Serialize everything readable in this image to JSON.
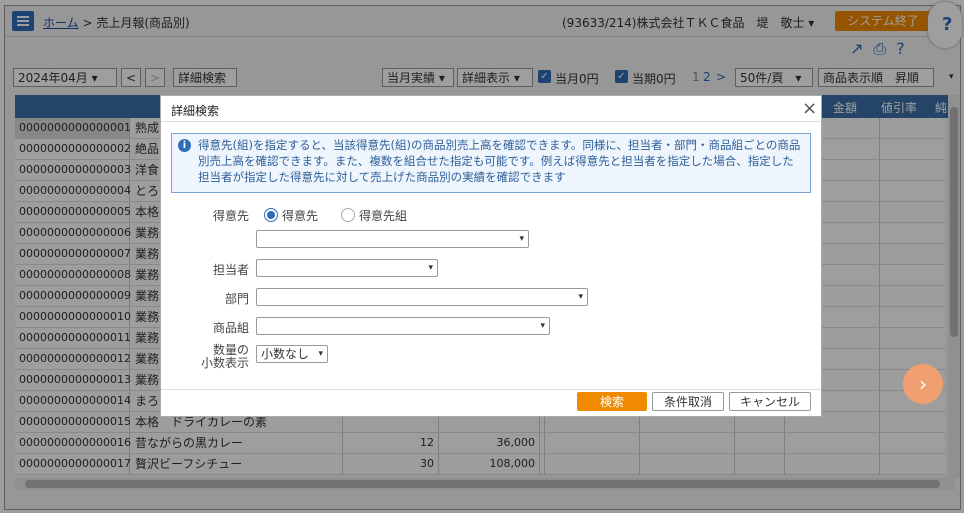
{
  "header": {
    "breadcrumb_home": "ホーム",
    "breadcrumb_sep": ">",
    "breadcrumb_current": "売上月報(商品別)",
    "user": "(93633/214)株式会社ＴＫＣ食品　堤　敬士 ▾",
    "system_exit": "システム終了"
  },
  "toolbar": {
    "month": "2024年04月 ▾",
    "prev": "<",
    "next": ">",
    "detail_search": "詳細検索",
    "current_results": "当月実績 ▾",
    "detail_display": "詳細表示 ▾",
    "zero_current": "当月0円",
    "zero_period": "当期0円",
    "page_1": "1",
    "page_2": "2",
    "page_next": ">",
    "per_page": "50件/頁　▾",
    "sort": "商品表示順　昇順",
    "sort_arrow": "▾"
  },
  "table": {
    "headers": [
      "金額",
      "値引率",
      "純"
    ],
    "rows": [
      {
        "code": "0000000000000001",
        "name": "熟成",
        "qty": "",
        "amount": ""
      },
      {
        "code": "0000000000000002",
        "name": "絶品",
        "qty": "",
        "amount": ""
      },
      {
        "code": "0000000000000003",
        "name": "洋食",
        "qty": "",
        "amount": ""
      },
      {
        "code": "0000000000000004",
        "name": "とろ",
        "qty": "",
        "amount": ""
      },
      {
        "code": "0000000000000005",
        "name": "本格",
        "qty": "",
        "amount": ""
      },
      {
        "code": "0000000000000006",
        "name": "業務",
        "qty": "",
        "amount": ""
      },
      {
        "code": "0000000000000007",
        "name": "業務",
        "qty": "",
        "amount": ""
      },
      {
        "code": "0000000000000008",
        "name": "業務",
        "qty": "",
        "amount": ""
      },
      {
        "code": "0000000000000009",
        "name": "業務",
        "qty": "",
        "amount": ""
      },
      {
        "code": "0000000000000010",
        "name": "業務",
        "qty": "",
        "amount": ""
      },
      {
        "code": "0000000000000011",
        "name": "業務",
        "qty": "",
        "amount": ""
      },
      {
        "code": "0000000000000012",
        "name": "業務",
        "qty": "",
        "amount": ""
      },
      {
        "code": "0000000000000013",
        "name": "業務",
        "qty": "",
        "amount": ""
      },
      {
        "code": "0000000000000014",
        "name": "まろ",
        "qty": "",
        "amount": ""
      },
      {
        "code": "0000000000000015",
        "name": "本格　ドライカレーの素",
        "qty": "",
        "amount": ""
      },
      {
        "code": "0000000000000016",
        "name": "昔ながらの黒カレー",
        "qty": "12",
        "amount": "36,000"
      },
      {
        "code": "0000000000000017",
        "name": "贅沢ビーフシチュー",
        "qty": "30",
        "amount": "108,000"
      }
    ]
  },
  "dialog": {
    "title": "詳細検索",
    "close": "×",
    "info_icon": "i",
    "info": "得意先(組)を指定すると、当該得意先(組)の商品別売上高を確認できます。同様に、担当者・部門・商品組ごとの商品別売上高を確認できます。また、複数を組合せた指定も可能です。例えば得意先と担当者を指定した場合、指定した担当者が指定した得意先に対して売上げた商品別の実績を確認できます",
    "customer_label": "得意先",
    "radio_customer": "得意先",
    "radio_customer_group": "得意先組",
    "staff_label": "担当者",
    "dept_label": "部門",
    "product_group_label": "商品組",
    "qty_label_1": "数量の",
    "qty_label_2": "小数表示",
    "qty_value": "小数なし",
    "arrow": "▾",
    "search": "検索",
    "clear": "条件取消",
    "cancel": "キャンセル"
  }
}
